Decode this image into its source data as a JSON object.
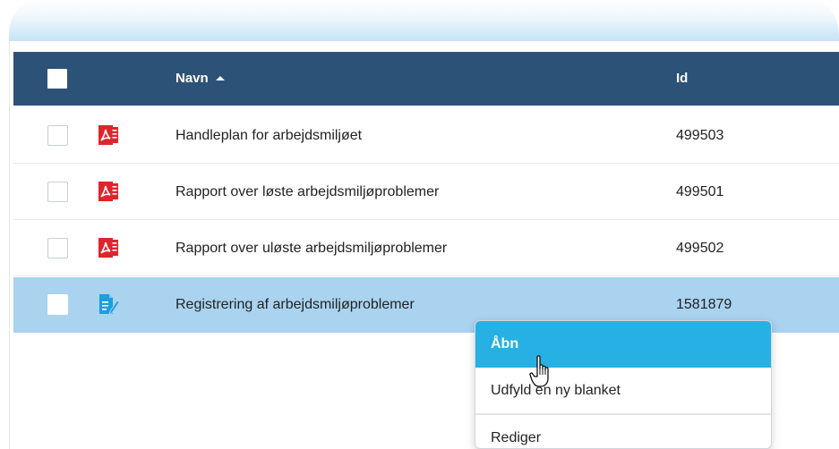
{
  "table": {
    "header": {
      "name_label": "Navn",
      "id_label": "Id",
      "sort_direction": "ascending"
    },
    "rows": [
      {
        "name": "Handleplan for arbejdsmiljøet",
        "id": "499503",
        "icon": "pdf-file-icon",
        "selected": false
      },
      {
        "name": "Rapport over løste arbejdsmiljøproblemer",
        "id": "499501",
        "icon": "pdf-file-icon",
        "selected": false
      },
      {
        "name": "Rapport over uløste arbejdsmiljøproblemer",
        "id": "499502",
        "icon": "pdf-file-icon",
        "selected": false
      },
      {
        "name": "Registrering af arbejdsmiljøproblemer",
        "id": "1581879",
        "icon": "form-edit-icon",
        "selected": true
      }
    ]
  },
  "context_menu": {
    "items": [
      {
        "label": "Åbn",
        "active": true
      },
      {
        "label": "Udfyld en ny blanket",
        "active": false
      },
      {
        "label": "Rediger",
        "active": false
      }
    ]
  },
  "colors": {
    "header_bg": "#2d5277",
    "selected_row_bg": "#a9d3ef",
    "menu_active_bg": "#27b0e3",
    "pdf_red": "#e0242c",
    "form_blue": "#1a9fe0"
  }
}
